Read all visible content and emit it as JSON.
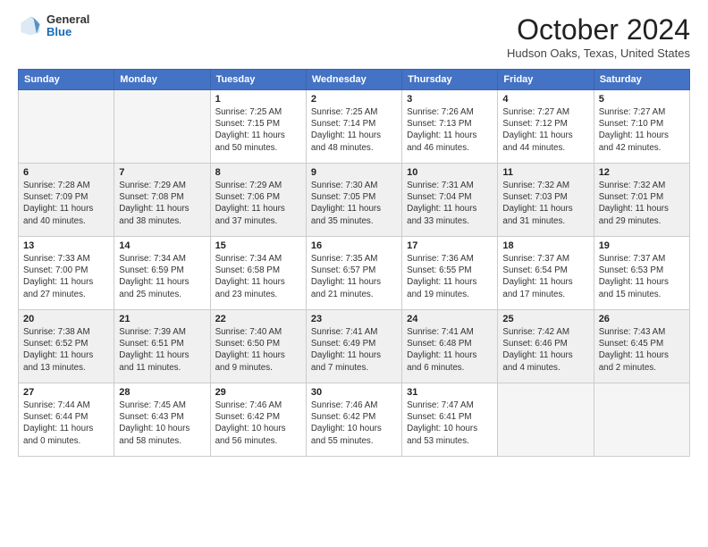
{
  "logo": {
    "line1": "General",
    "line2": "Blue"
  },
  "title": "October 2024",
  "location": "Hudson Oaks, Texas, United States",
  "weekdays": [
    "Sunday",
    "Monday",
    "Tuesday",
    "Wednesday",
    "Thursday",
    "Friday",
    "Saturday"
  ],
  "weeks": [
    [
      {
        "day": "",
        "info": ""
      },
      {
        "day": "",
        "info": ""
      },
      {
        "day": "1",
        "info": "Sunrise: 7:25 AM\nSunset: 7:15 PM\nDaylight: 11 hours and 50 minutes."
      },
      {
        "day": "2",
        "info": "Sunrise: 7:25 AM\nSunset: 7:14 PM\nDaylight: 11 hours and 48 minutes."
      },
      {
        "day": "3",
        "info": "Sunrise: 7:26 AM\nSunset: 7:13 PM\nDaylight: 11 hours and 46 minutes."
      },
      {
        "day": "4",
        "info": "Sunrise: 7:27 AM\nSunset: 7:12 PM\nDaylight: 11 hours and 44 minutes."
      },
      {
        "day": "5",
        "info": "Sunrise: 7:27 AM\nSunset: 7:10 PM\nDaylight: 11 hours and 42 minutes."
      }
    ],
    [
      {
        "day": "6",
        "info": "Sunrise: 7:28 AM\nSunset: 7:09 PM\nDaylight: 11 hours and 40 minutes."
      },
      {
        "day": "7",
        "info": "Sunrise: 7:29 AM\nSunset: 7:08 PM\nDaylight: 11 hours and 38 minutes."
      },
      {
        "day": "8",
        "info": "Sunrise: 7:29 AM\nSunset: 7:06 PM\nDaylight: 11 hours and 37 minutes."
      },
      {
        "day": "9",
        "info": "Sunrise: 7:30 AM\nSunset: 7:05 PM\nDaylight: 11 hours and 35 minutes."
      },
      {
        "day": "10",
        "info": "Sunrise: 7:31 AM\nSunset: 7:04 PM\nDaylight: 11 hours and 33 minutes."
      },
      {
        "day": "11",
        "info": "Sunrise: 7:32 AM\nSunset: 7:03 PM\nDaylight: 11 hours and 31 minutes."
      },
      {
        "day": "12",
        "info": "Sunrise: 7:32 AM\nSunset: 7:01 PM\nDaylight: 11 hours and 29 minutes."
      }
    ],
    [
      {
        "day": "13",
        "info": "Sunrise: 7:33 AM\nSunset: 7:00 PM\nDaylight: 11 hours and 27 minutes."
      },
      {
        "day": "14",
        "info": "Sunrise: 7:34 AM\nSunset: 6:59 PM\nDaylight: 11 hours and 25 minutes."
      },
      {
        "day": "15",
        "info": "Sunrise: 7:34 AM\nSunset: 6:58 PM\nDaylight: 11 hours and 23 minutes."
      },
      {
        "day": "16",
        "info": "Sunrise: 7:35 AM\nSunset: 6:57 PM\nDaylight: 11 hours and 21 minutes."
      },
      {
        "day": "17",
        "info": "Sunrise: 7:36 AM\nSunset: 6:55 PM\nDaylight: 11 hours and 19 minutes."
      },
      {
        "day": "18",
        "info": "Sunrise: 7:37 AM\nSunset: 6:54 PM\nDaylight: 11 hours and 17 minutes."
      },
      {
        "day": "19",
        "info": "Sunrise: 7:37 AM\nSunset: 6:53 PM\nDaylight: 11 hours and 15 minutes."
      }
    ],
    [
      {
        "day": "20",
        "info": "Sunrise: 7:38 AM\nSunset: 6:52 PM\nDaylight: 11 hours and 13 minutes."
      },
      {
        "day": "21",
        "info": "Sunrise: 7:39 AM\nSunset: 6:51 PM\nDaylight: 11 hours and 11 minutes."
      },
      {
        "day": "22",
        "info": "Sunrise: 7:40 AM\nSunset: 6:50 PM\nDaylight: 11 hours and 9 minutes."
      },
      {
        "day": "23",
        "info": "Sunrise: 7:41 AM\nSunset: 6:49 PM\nDaylight: 11 hours and 7 minutes."
      },
      {
        "day": "24",
        "info": "Sunrise: 7:41 AM\nSunset: 6:48 PM\nDaylight: 11 hours and 6 minutes."
      },
      {
        "day": "25",
        "info": "Sunrise: 7:42 AM\nSunset: 6:46 PM\nDaylight: 11 hours and 4 minutes."
      },
      {
        "day": "26",
        "info": "Sunrise: 7:43 AM\nSunset: 6:45 PM\nDaylight: 11 hours and 2 minutes."
      }
    ],
    [
      {
        "day": "27",
        "info": "Sunrise: 7:44 AM\nSunset: 6:44 PM\nDaylight: 11 hours and 0 minutes."
      },
      {
        "day": "28",
        "info": "Sunrise: 7:45 AM\nSunset: 6:43 PM\nDaylight: 10 hours and 58 minutes."
      },
      {
        "day": "29",
        "info": "Sunrise: 7:46 AM\nSunset: 6:42 PM\nDaylight: 10 hours and 56 minutes."
      },
      {
        "day": "30",
        "info": "Sunrise: 7:46 AM\nSunset: 6:42 PM\nDaylight: 10 hours and 55 minutes."
      },
      {
        "day": "31",
        "info": "Sunrise: 7:47 AM\nSunset: 6:41 PM\nDaylight: 10 hours and 53 minutes."
      },
      {
        "day": "",
        "info": ""
      },
      {
        "day": "",
        "info": ""
      }
    ]
  ]
}
